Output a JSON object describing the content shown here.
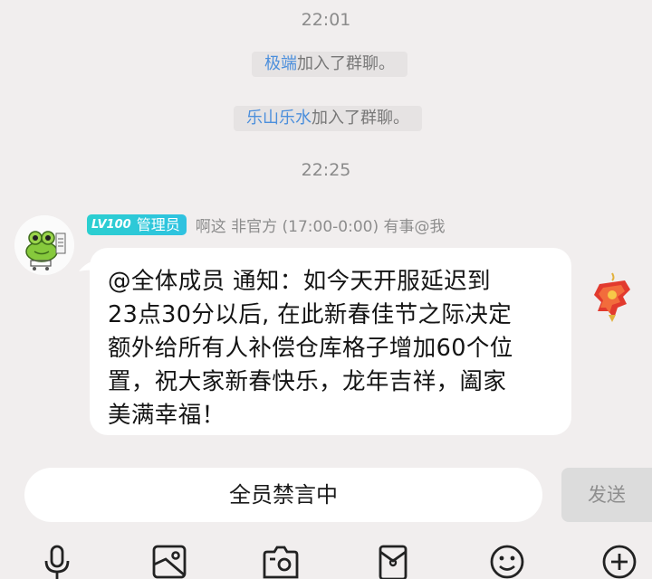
{
  "messages": {
    "time_1": "22:01",
    "join_1": {
      "name": "极端",
      "text": "加入了群聊。"
    },
    "join_2": {
      "name": "乐山乐水",
      "text": "加入了群聊。"
    },
    "time_2": "22:25"
  },
  "chat_message": {
    "badge_level": "LV100",
    "badge_role": "管理员",
    "sender_title": "啊这 非官方 (17:00-0:00) 有事@我",
    "lines": [
      "@全体成员 通知：如今天开服延迟到",
      "23点30分以后, 在此新春佳节之际决定",
      "额外给所有人补偿仓库格子增加60个位",
      "置，祝大家新春快乐，龙年吉祥，阖家",
      "美满幸福！"
    ]
  },
  "input_area": {
    "mute_text": "全员禁言中",
    "send_label": "发送"
  },
  "toolbar": {
    "icons": [
      "microphone-icon",
      "image-icon",
      "camera-icon",
      "red-packet-icon",
      "emoji-icon",
      "plus-icon"
    ]
  },
  "colors": {
    "background": "#f1eeee",
    "name_link": "#4c8fdc",
    "badge": "#2bcfd0",
    "send_disabled": "#dcdcdc"
  }
}
